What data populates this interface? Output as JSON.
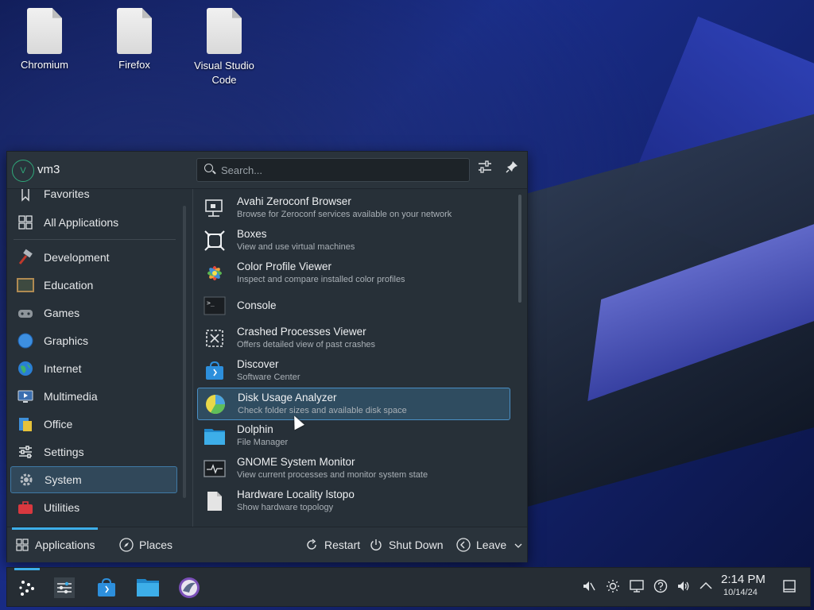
{
  "desktop": {
    "icons": [
      {
        "label": "Chromium",
        "icon": "file-icon"
      },
      {
        "label": "Firefox",
        "icon": "file-icon"
      },
      {
        "label": "Visual Studio Code",
        "icon": "file-icon"
      }
    ]
  },
  "launcher": {
    "header": {
      "avatar_letter": "V",
      "username": "vm3",
      "search_placeholder": "Search...",
      "configure_icon": "sliders-icon",
      "pin_icon": "pin-icon"
    },
    "sidebar": {
      "items": [
        {
          "label": "Favorites",
          "icon": "bookmark-icon",
          "selected": false
        },
        {
          "label": "All Applications",
          "icon": "grid-icon",
          "selected": false
        },
        {
          "label": "Development",
          "icon": "hammer-icon",
          "selected": false
        },
        {
          "label": "Education",
          "icon": "chalkboard-icon",
          "selected": false
        },
        {
          "label": "Games",
          "icon": "gamepad-icon",
          "selected": false
        },
        {
          "label": "Graphics",
          "icon": "graphics-icon",
          "selected": false
        },
        {
          "label": "Internet",
          "icon": "globe-icon",
          "selected": false
        },
        {
          "label": "Multimedia",
          "icon": "multimedia-icon",
          "selected": false
        },
        {
          "label": "Office",
          "icon": "office-icon",
          "selected": false
        },
        {
          "label": "Settings",
          "icon": "sliders-icon",
          "selected": false
        },
        {
          "label": "System",
          "icon": "gear-icon",
          "selected": true
        },
        {
          "label": "Utilities",
          "icon": "toolbox-icon",
          "selected": false
        }
      ]
    },
    "apps": [
      {
        "name": "Avahi Zeroconf Browser",
        "desc": "Browse for Zeroconf services available on your network",
        "icon": "network-icon"
      },
      {
        "name": "Boxes",
        "desc": "View and use virtual machines",
        "icon": "boxes-icon"
      },
      {
        "name": "Color Profile Viewer",
        "desc": "Inspect and compare installed color profiles",
        "icon": "color-icon"
      },
      {
        "name": "Console",
        "desc": "",
        "icon": "terminal-icon"
      },
      {
        "name": "Crashed Processes Viewer",
        "desc": "Offers detailed view of past crashes",
        "icon": "crash-icon"
      },
      {
        "name": "Discover",
        "desc": "Software Center",
        "icon": "store-icon"
      },
      {
        "name": "Disk Usage Analyzer",
        "desc": "Check folder sizes and available disk space",
        "icon": "pie-chart-icon",
        "selected": true
      },
      {
        "name": "Dolphin",
        "desc": "File Manager",
        "icon": "folder-icon"
      },
      {
        "name": "GNOME System Monitor",
        "desc": "View current processes and monitor system state",
        "icon": "monitor-icon"
      },
      {
        "name": "Hardware Locality lstopo",
        "desc": "Show hardware topology",
        "icon": "file-icon"
      }
    ],
    "footer": {
      "applications_label": "Applications",
      "places_label": "Places",
      "restart_label": "Restart",
      "shutdown_label": "Shut Down",
      "leave_label": "Leave"
    }
  },
  "taskbar": {
    "clock_time": "2:14 PM",
    "clock_date": "10/14/24"
  }
}
